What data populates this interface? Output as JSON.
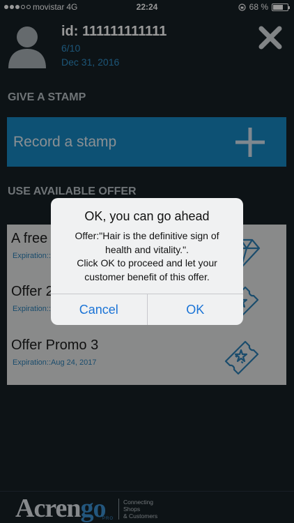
{
  "status_bar": {
    "carrier": "movistar",
    "network": "4G",
    "time": "22:24",
    "battery": "68 %",
    "battery_level": 0.68
  },
  "profile": {
    "user_id": "id: 111111111111",
    "progress": "6/10",
    "date": "Dec 31, 2016"
  },
  "stamp_section": {
    "title": "GIVE A STAMP",
    "button_label": "Record a stamp"
  },
  "offers_section": {
    "title": "USE AVAILABLE OFFER",
    "items": [
      {
        "title": "A free",
        "expiration": "Expiration::",
        "icon": "diamond-icon"
      },
      {
        "title": "Offer 2",
        "expiration": "Expiration::",
        "icon": "ticket-icon"
      },
      {
        "title": "Offer Promo 3",
        "expiration": "Expiration::Aug 24, 2017",
        "icon": "ticket-icon"
      }
    ]
  },
  "dialog": {
    "title": "OK, you can go ahead",
    "message_lines": [
      "Offer:\"Hair is the definitive sign of",
      "health and vitality.\".",
      "Click OK to proceed and let your",
      "customer benefit of this offer."
    ],
    "cancel_label": "Cancel",
    "ok_label": "OK"
  },
  "footer": {
    "brand_main": "Acren",
    "brand_accent": "go",
    "brand_sub": "PRO",
    "tagline": [
      "Connecting",
      "Shops",
      "& Customers"
    ]
  },
  "colors": {
    "background": "#162026",
    "accent": "#1687c2",
    "link": "#2f8ec7",
    "dialog_button": "#1a73d6"
  }
}
